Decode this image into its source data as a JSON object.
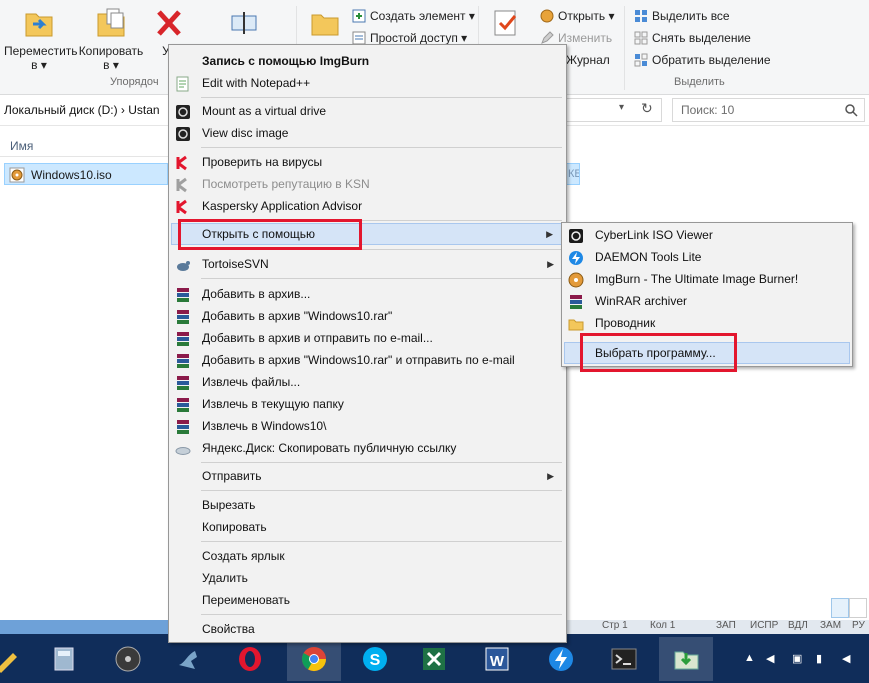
{
  "ribbon": {
    "move_label_1": "Переместить",
    "move_label_2": "в ▾",
    "copy_label_1": "Копировать",
    "copy_label_2": "в ▾",
    "delete_label": "Уд",
    "group_organize": "Упорядоч",
    "new_item": "Создать элемент ▾",
    "easy_access": "Простой доступ ▾",
    "open": "Открыть ▾",
    "edit": "Изменить",
    "history": "Журнал",
    "select_all": "Выделить все",
    "select_none": "Снять выделение",
    "invert_selection": "Обратить выделение",
    "group_select": "Выделить"
  },
  "address": {
    "path_1": "Локальный диск (D:)",
    "path_2": "Ustan",
    "search_placeholder": "Поиск: 10"
  },
  "file_list": {
    "column_name": "Имя",
    "file_name": "Windows10.iso",
    "size_fragment": "КБ"
  },
  "context_menu": {
    "items": [
      "Запись с помощью ImgBurn",
      "Edit with Notepad++",
      "Mount as a virtual drive",
      "View disc image",
      "Проверить на вирусы",
      "Посмотреть репутацию в KSN",
      "Kaspersky Application Advisor",
      "Открыть с помощью",
      "TortoiseSVN",
      "Добавить в архив...",
      "Добавить в архив \"Windows10.rar\"",
      "Добавить в архив и отправить по e-mail...",
      "Добавить в архив \"Windows10.rar\" и отправить по e-mail",
      "Извлечь файлы...",
      "Извлечь в текущую папку",
      "Извлечь в Windows10\\",
      "Яндекс.Диск: Скопировать публичную ссылку",
      "Отправить",
      "Вырезать",
      "Копировать",
      "Создать ярлык",
      "Удалить",
      "Переименовать",
      "Свойства"
    ]
  },
  "submenu": {
    "items": [
      "CyberLink ISO Viewer",
      "DAEMON Tools Lite",
      "ImgBurn - The Ultimate Image Burner!",
      "WinRAR archiver",
      "Проводник",
      "Выбрать программу..."
    ]
  },
  "statusbar": {
    "line": "Стр 1",
    "col": "Кол 1",
    "caps": "ЗАП",
    "ins": "ИСПР",
    "num": "ВДЛ",
    "scroll": "ЗАМ",
    "lang": "РУ"
  },
  "colors": {
    "highlight_red": "#e3162e",
    "menu_highlight": "#d5e4f7",
    "taskbar": "#102d5a",
    "selection": "#cce8ff"
  }
}
